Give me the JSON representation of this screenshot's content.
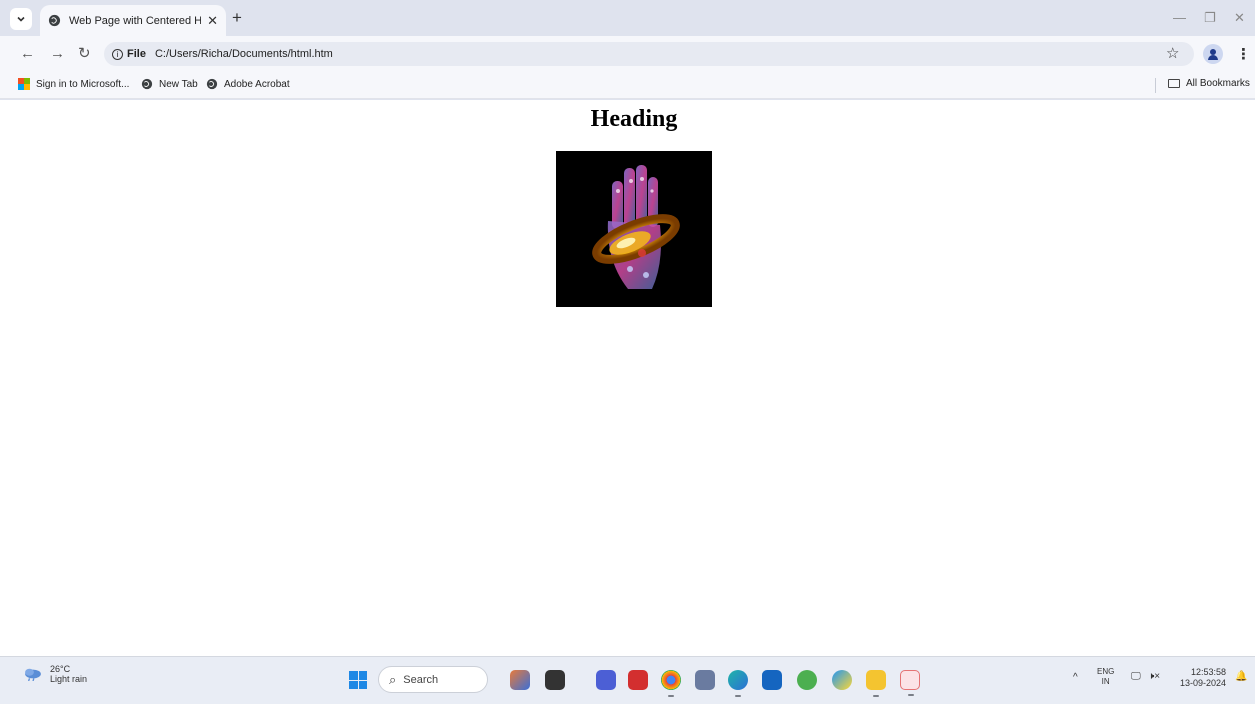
{
  "browser": {
    "tab_title": "Web Page with Centered Head",
    "tab_close": "✕",
    "new_tab": "+",
    "address_scheme": "File",
    "address_url": "C:/Users/Richa/Documents/html.htm",
    "bookmarks": [
      {
        "label": "Sign in to Microsoft..."
      },
      {
        "label": "New Tab"
      },
      {
        "label": "Adobe Acrobat"
      }
    ],
    "all_bookmarks": "All Bookmarks"
  },
  "page": {
    "heading": "Heading"
  },
  "taskbar": {
    "weather_temp": "26°C",
    "weather_desc": "Light rain",
    "search_label": "Search",
    "lang_top": "ENG",
    "lang_bottom": "IN",
    "time": "12:53:58",
    "date": "13-09-2024"
  },
  "colors": {
    "accent_blue": "#1e88e5",
    "chrome_bg": "#dfe3ee"
  }
}
